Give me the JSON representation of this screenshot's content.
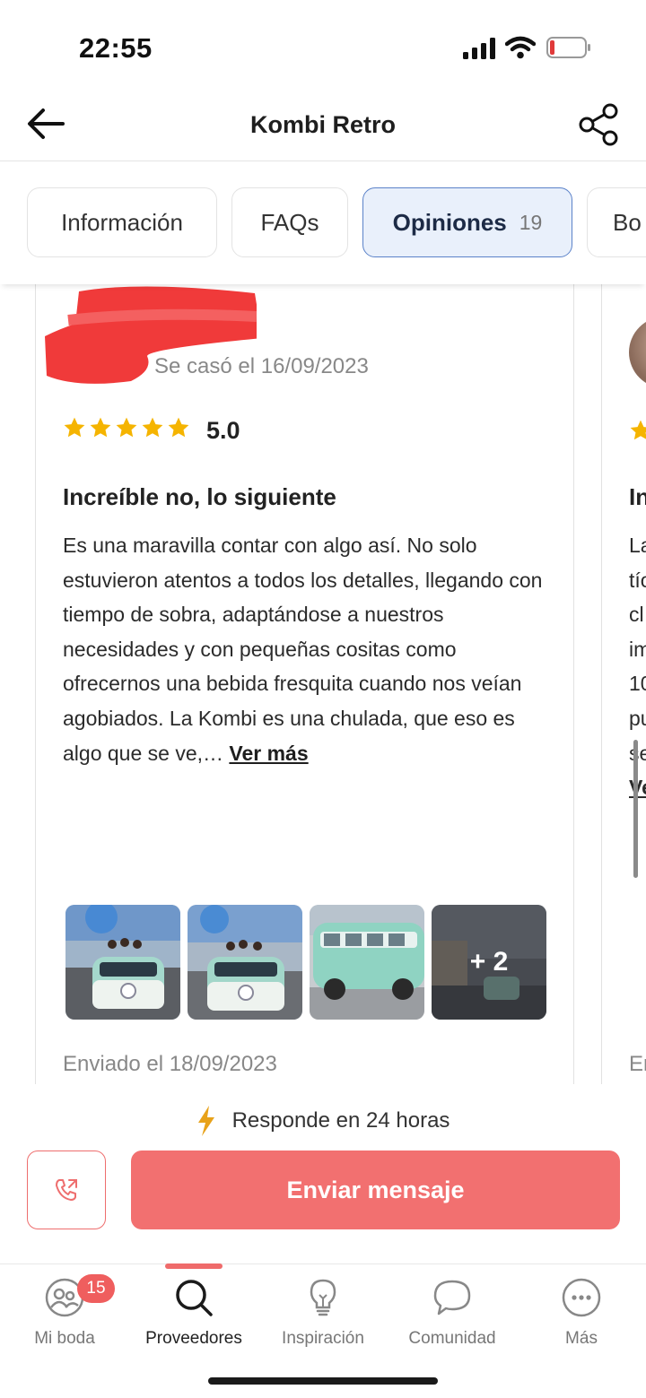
{
  "status_bar": {
    "time": "22:55"
  },
  "header": {
    "title": "Kombi Retro"
  },
  "tabs": [
    {
      "label": "Información",
      "count": ""
    },
    {
      "label": "FAQs",
      "count": ""
    },
    {
      "label": "Opiniones",
      "count": "19"
    },
    {
      "label": "Bo",
      "count": ""
    }
  ],
  "review": {
    "married_date": "Se casó el 16/09/2023",
    "rating": "5.0",
    "stars": 5,
    "title": "Increíble no, lo siguiente",
    "body": "Es una maravilla contar con algo así. No solo estuvieron atentos a todos los detalles, llegando con tiempo de sobra, adaptándose a nuestros necesidades y con pequeñas cositas como ofrecernos una bebida fresquita cuando nos veían agobiados. La Kombi es una chulada, que eso es algo que se ve,… ",
    "see_more": "Ver más",
    "photos_more": "+ 2",
    "sent_date": "Enviado el 18/09/2023"
  },
  "next_review": {
    "title_fragment": "In",
    "line_fragments": [
      "La",
      "tío",
      "cl",
      "im",
      "10",
      "pu",
      "se",
      "Ve"
    ],
    "sent_fragment": "En"
  },
  "actions": {
    "response_time": "Responde en 24 horas",
    "send_message": "Enviar mensaje"
  },
  "bottom_nav": {
    "items": [
      {
        "label": "Mi boda",
        "icon": "people-icon"
      },
      {
        "label": "Proveedores",
        "icon": "search-icon"
      },
      {
        "label": "Inspiración",
        "icon": "lightbulb-icon"
      },
      {
        "label": "Comunidad",
        "icon": "chat-bubble-icon"
      },
      {
        "label": "Más",
        "icon": "more-dots-icon"
      }
    ],
    "badge": "15"
  },
  "colors": {
    "accent": "#f27070",
    "active_tab_bg": "#e9f0fb",
    "active_tab_border": "#5b82c9",
    "star": "#f5b400"
  }
}
